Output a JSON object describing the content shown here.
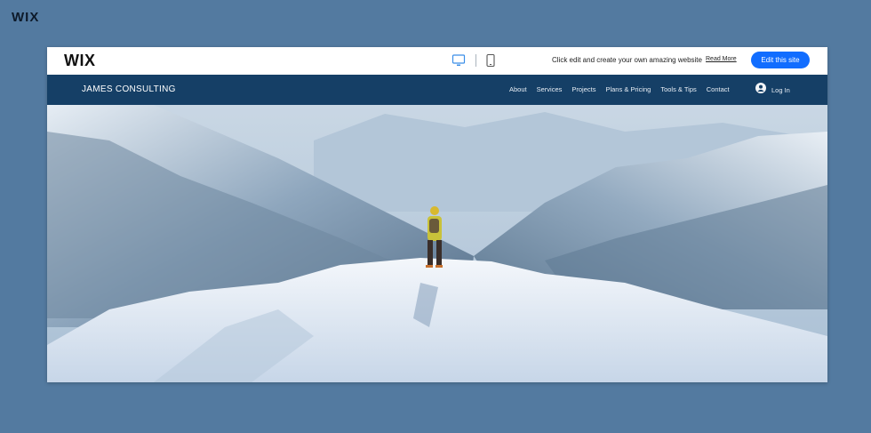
{
  "corner": {
    "logo": "WIX"
  },
  "topbar": {
    "logo": "WIX",
    "promo_text": "Click edit and create your own amazing website",
    "read_more": "Read More",
    "edit_button": "Edit this site",
    "device_icons": [
      "desktop-icon",
      "mobile-icon"
    ]
  },
  "site": {
    "title": "JAMES CONSULTING",
    "menu": [
      "About",
      "Services",
      "Projects",
      "Plans & Pricing",
      "Tools & Tips",
      "Contact"
    ],
    "login": "Log In"
  },
  "colors": {
    "page_bg": "#537aa0",
    "nav_bg": "#153f66",
    "accent": "#116dff"
  }
}
